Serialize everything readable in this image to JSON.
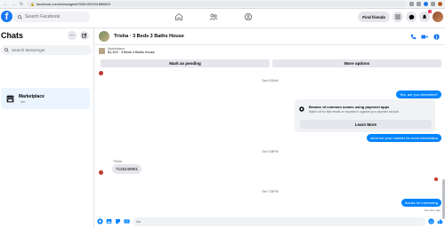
{
  "browser": {
    "url": "facebook.com/messages/t/9281902391868810"
  },
  "nav": {
    "logo": "f",
    "search_placeholder": "Search Facebook",
    "find_friends_label": "Find friends",
    "notification_count": "1"
  },
  "left": {
    "title": "Chats",
    "search_placeholder": "Search Messenger",
    "chat_items": [
      {
        "name": "Marketplace",
        "sub": "· 3m"
      }
    ]
  },
  "conversation": {
    "title": "Trisha · 3 Beds 3 Baths House",
    "listing": {
      "category": "Marketplace",
      "price_line": "$1,324 · 3 Beds 3 Baths House"
    },
    "buttons": {
      "mark_pending": "Mark as pending",
      "more_options": "More options"
    },
    "timestamps": [
      "Sat 4:25AM",
      "Sat 3:08PM",
      "Sat 7:25PM"
    ],
    "messages": {
      "yes_interested": "Yes, are you interested?",
      "send_number": "send me your number for more information",
      "sender_name": "Trisha",
      "incoming_number": "7125246951",
      "thanks": "thanks for interesting"
    },
    "scam": {
      "title": "Beware of common scams using payment apps",
      "text": "Watch out for fake emails or requests to upgrade your payment account.",
      "learn_more": "Learn More"
    },
    "seen": "Sent 11m ago",
    "composer_placeholder": "Aa"
  },
  "colors": {
    "brand": "#1877f2",
    "bubble_out": "#0084ff",
    "bubble_in": "#e4e6eb"
  }
}
